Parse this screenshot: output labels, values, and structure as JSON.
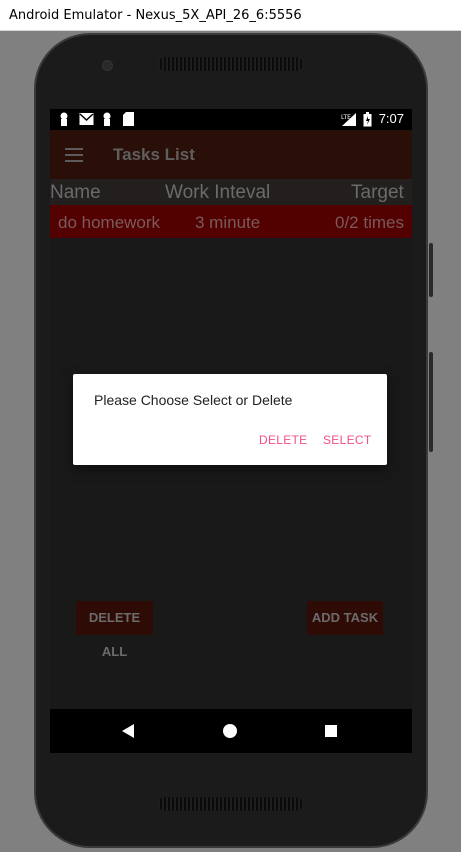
{
  "window": {
    "title": "Android Emulator - Nexus_5X_API_26_6:5556"
  },
  "status_bar": {
    "time": "7:07",
    "network_label": "LTE",
    "left_icons": [
      "notification-icon",
      "mail-icon",
      "notification-icon",
      "sd-card-icon"
    ],
    "right_icons": [
      "lte-signal-icon",
      "battery-icon"
    ]
  },
  "toolbar": {
    "title": "Tasks List",
    "menu_icon": "hamburger-menu-icon"
  },
  "table": {
    "columns": [
      "Name",
      "Work Inteval",
      "Target"
    ],
    "rows": [
      {
        "name": "do homework",
        "interval": "3 minute",
        "target": "0/2 times"
      }
    ]
  },
  "dialog": {
    "message": "Please Choose Select or Delete",
    "delete_label": "DELETE",
    "select_label": "SELECT",
    "accent_color": "#f0508a"
  },
  "buttons": {
    "delete_all": "DELETE ALL",
    "add_task": "ADD TASK"
  },
  "nav_bar": {
    "icons": [
      "back-icon",
      "home-icon",
      "recents-icon"
    ]
  },
  "colors": {
    "toolbar": "#2a0e08",
    "task_row": "#520000",
    "button_bg": "#2e0b05"
  }
}
